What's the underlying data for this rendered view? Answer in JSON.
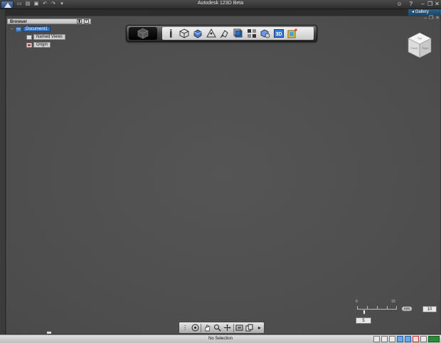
{
  "window": {
    "title": "Autodesk 123D Beta"
  },
  "quick_access": {
    "icons": [
      "new-file-icon",
      "open-icon",
      "save-icon",
      "undo-icon",
      "redo-icon",
      "dropdown-icon"
    ],
    "undo_glyph": "↶",
    "redo_glyph": "↷",
    "dropdown_glyph": "▾"
  },
  "title_right": {
    "signin_icon": "user-icon",
    "help_glyph": "?"
  },
  "window_controls": {
    "minimize": "–",
    "restore": "❐",
    "close": "✕"
  },
  "gallery": {
    "label": "Gallery",
    "arrow": "◂"
  },
  "subwindow_controls": {
    "minimize": "–",
    "restore": "❐",
    "close": "✕"
  },
  "browser": {
    "title": "Browser",
    "pin_glyph": "▮",
    "close_glyph": "×",
    "nodes": [
      {
        "label": "Document1",
        "expander": "–",
        "icon": "document-icon",
        "selected": true
      },
      {
        "label": "Named Views",
        "expander": "+",
        "icon": "named-views-icon",
        "selected": false
      },
      {
        "label": "Origin",
        "expander": "+",
        "icon": "origin-icon",
        "selected": false
      }
    ]
  },
  "toolbar": {
    "tools": [
      "transform-icon",
      "primitives-icon",
      "sketch-icon",
      "construct-icon",
      "modify-icon",
      "pattern-icon",
      "grouping-icon",
      "combine-icon",
      "text-icon",
      "materials-icon"
    ],
    "text_tool_label": "3D"
  },
  "viewcube": {
    "faces": [
      "Top",
      "Front",
      "Right"
    ]
  },
  "scale": {
    "start_label": "0",
    "end_label": "10",
    "value": "5",
    "unit": "mm",
    "grid_value": "10"
  },
  "navbar": {
    "tools": [
      "orbit-icon",
      "pan-icon",
      "zoom-icon",
      "look-at-icon",
      "fit-icon",
      "view-icon"
    ],
    "more_glyph": "▸"
  },
  "status": {
    "text": "No Selection"
  },
  "colors": {
    "selection": "#2f6fc0",
    "viewport": "#4f4f4f",
    "gallery": "#2f5f86"
  }
}
